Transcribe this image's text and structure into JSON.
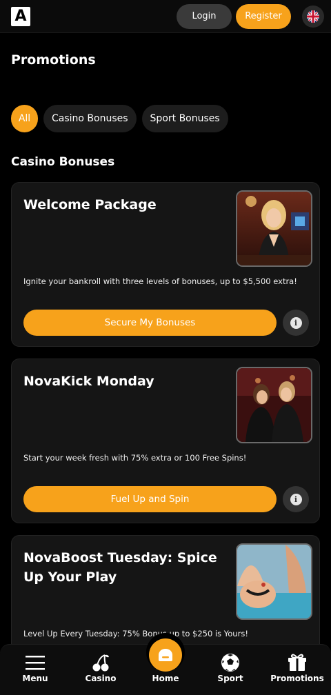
{
  "header": {
    "logo_text": "A",
    "login_label": "Login",
    "register_label": "Register",
    "language_icon": "uk-flag-icon"
  },
  "page": {
    "title": "Promotions",
    "filters": [
      "All",
      "Casino Bonuses",
      "Sport Bonuses"
    ],
    "active_filter": "All",
    "section_title": "Casino Bonuses"
  },
  "cards": [
    {
      "title": "Welcome Package",
      "description": "Ignite your bankroll with three levels of bonuses, up to $5,500 extra!",
      "cta": "Secure My Bonuses",
      "image": "woman-at-casino-table-photo"
    },
    {
      "title": "NovaKick Monday",
      "description": "Start your week fresh with 75% extra or 100 Free Spins!",
      "cta": "Fuel Up and Spin",
      "image": "two-women-in-suits-photo"
    },
    {
      "title": "NovaBoost Tuesday: Spice Up Your Play",
      "description": "Level Up Every Tuesday: 75% Bonus up to $250 is Yours!",
      "image": "pool-party-photo"
    }
  ],
  "bottom_nav": {
    "items": [
      {
        "label": "Menu",
        "icon": "hamburger-icon"
      },
      {
        "label": "Casino",
        "icon": "cherries-icon"
      },
      {
        "label": "Home",
        "icon": "home-chat-icon"
      },
      {
        "label": "Sport",
        "icon": "soccer-ball-icon"
      },
      {
        "label": "Promotions",
        "icon": "gift-icon"
      }
    ]
  },
  "colors": {
    "accent": "#f7a21b",
    "background": "#000000",
    "card": "#151515"
  }
}
